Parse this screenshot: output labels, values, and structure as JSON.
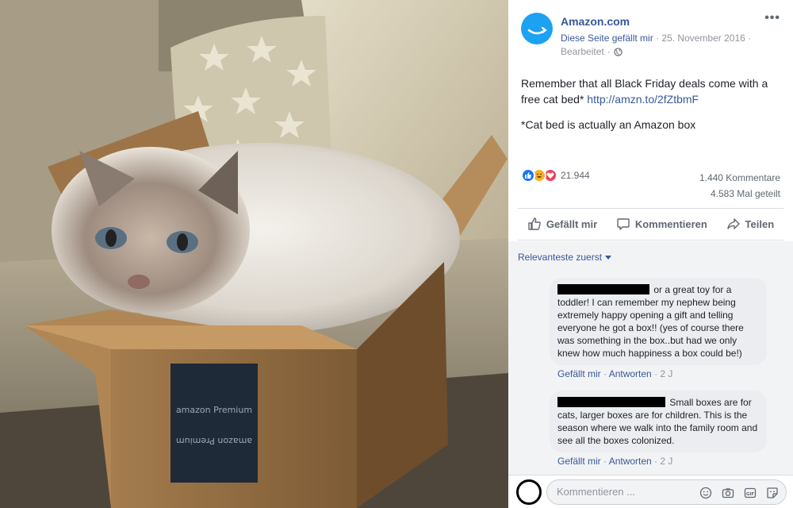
{
  "photo": {
    "alt": "Cat lying in an Amazon Prime box",
    "box_text_top": "amazon Premium",
    "box_text_bottom": "amazon Premium"
  },
  "post": {
    "page_name": "Amazon.com",
    "liked_label": "Diese Seite gefällt mir",
    "date": "25. November 2016",
    "edited": "Bearbeitet",
    "separator": "·",
    "text_main": "Remember that all Black Friday deals come with a free cat bed*",
    "link": "http://amzn.to/2fZtbmF",
    "footnote": "*Cat bed is actually an Amazon box",
    "more_icon": "ellipsis-icon"
  },
  "stats": {
    "reaction_count": "21.944",
    "comments": "1.440 Kommentare",
    "shares": "4.583 Mal geteilt",
    "reaction_icons": [
      "like-icon",
      "haha-icon",
      "love-icon"
    ]
  },
  "actions": {
    "like": "Gefällt mir",
    "comment": "Kommentieren",
    "share": "Teilen"
  },
  "comments_section": {
    "sort_label": "Relevanteste zuerst",
    "items": [
      {
        "text": "or a great toy for a toddler! I can remember my nephew being extremely happy opening a gift and telling everyone he got a box!! (yes of course there was something in the box..but had we only knew how much happiness a box could be!)",
        "like": "Gefällt mir",
        "reply": "Antworten",
        "time": "2 J"
      },
      {
        "text": "Small boxes are for cats, larger boxes are for children. This is the season where we walk into the family room and see all the boxes colonized.",
        "like": "Gefällt mir",
        "reply": "Antworten",
        "time": "2 J"
      }
    ]
  },
  "composer": {
    "placeholder": "Kommentieren ...",
    "icons": [
      "emoji-icon",
      "camera-icon",
      "gif-icon",
      "sticker-icon"
    ]
  },
  "colors": {
    "link": "#385898",
    "meta": "#90949c",
    "brand_blue": "#1da1f2",
    "like": "#1877f2",
    "haha": "#f7b125",
    "love": "#f33e58"
  }
}
